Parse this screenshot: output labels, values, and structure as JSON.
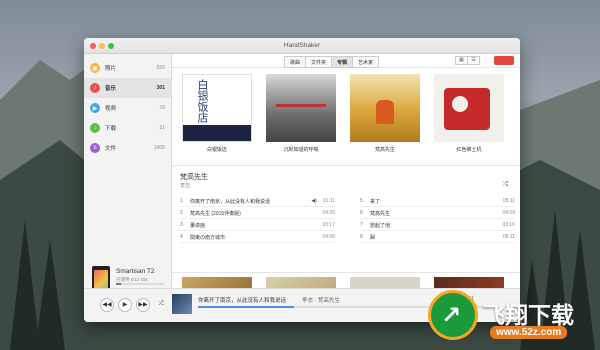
{
  "window": {
    "title": "HandShaker"
  },
  "colors": {
    "close": "#fc605b",
    "minimize": "#fdbc40",
    "maximize": "#34c84a",
    "accent": "#e0463c",
    "progress": "#4a90e2"
  },
  "sidebar": {
    "items": [
      {
        "label": "照片",
        "count": "520",
        "icon": "photo-icon",
        "color": "#f4b63b"
      },
      {
        "label": "音乐",
        "count": "301",
        "icon": "music-icon",
        "color": "#e8524a"
      },
      {
        "label": "视频",
        "count": "76",
        "icon": "video-icon",
        "color": "#3aa8e8"
      },
      {
        "label": "下载",
        "count": "21",
        "icon": "download-icon",
        "color": "#5bbf4a"
      },
      {
        "label": "文件",
        "count": "1005",
        "icon": "file-icon",
        "color": "#a05cd8"
      }
    ]
  },
  "device": {
    "name": "Smartisan T2",
    "used": "已使用 5/12 GB",
    "storage_fraction": 0.1,
    "eject_label": "弹出手机"
  },
  "toolbar": {
    "tabs": [
      "歌曲",
      "文件夹",
      "专辑",
      "艺术家"
    ],
    "active_tab": 2
  },
  "albums": [
    {
      "name": "白银饭店",
      "cover_text": "白银饭店"
    },
    {
      "name": "沉默如谜的呼吸"
    },
    {
      "name": "梵高先生"
    },
    {
      "name": "红色推土机"
    }
  ],
  "detail": {
    "title": "梵高先生",
    "artist": "李志",
    "tracks_left": [
      {
        "num": "1",
        "name": "你离开了南京，从此没有人和我说话",
        "dur": "01:11",
        "playing": true
      },
      {
        "num": "2",
        "name": "梵高先生 (2015伴奏版)",
        "dur": "04:26"
      },
      {
        "num": "3",
        "name": "董卓庙",
        "dur": "03:17"
      },
      {
        "num": "4",
        "name": "関東の南方城市",
        "dur": "04:06"
      }
    ],
    "tracks_right": [
      {
        "num": "5",
        "name": "来了",
        "dur": "05:11"
      },
      {
        "num": "6",
        "name": "梵高先生",
        "dur": "04:09"
      },
      {
        "num": "7",
        "name": "想起了他",
        "dur": "03:16"
      },
      {
        "num": "8",
        "name": "歸",
        "dur": "05:11"
      }
    ]
  },
  "player": {
    "title": "你离开了南京，从此没有人和我说话",
    "artist": "李志 · 梵高先生",
    "time": "01:11",
    "progress": 0.33
  },
  "watermark": {
    "text": "飞翔下载",
    "url": "www.52z.com"
  }
}
